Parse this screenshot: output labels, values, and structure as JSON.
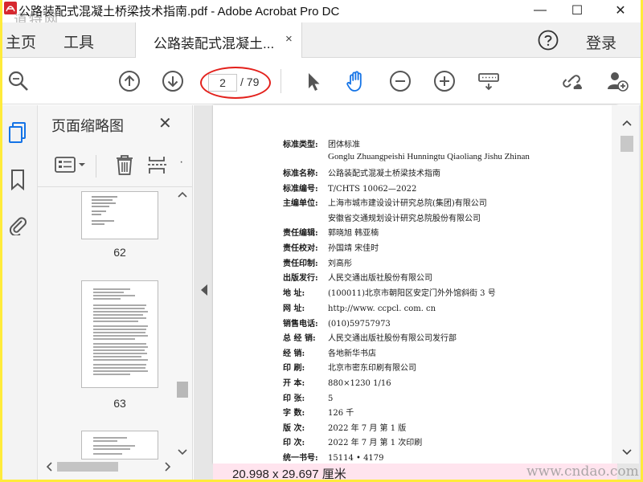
{
  "window": {
    "title": "公路装配式混凝土桥梁技术指南.pdf - Adobe Acrobat Pro DC",
    "watermark_top": "道特网",
    "controls": {
      "minimize": "—",
      "maximize": "☐",
      "close": "✕"
    }
  },
  "tabs": {
    "home": "主页",
    "tools": "工具",
    "document": "公路装配式混凝土...",
    "close": "×",
    "sign_in": "登录"
  },
  "toolbar": {
    "current_page": "2",
    "total_pages": "/ 79"
  },
  "panel": {
    "title": "页面缩略图",
    "close": "✕",
    "thumbnails": [
      {
        "label": "62"
      },
      {
        "label": "63"
      }
    ]
  },
  "document": {
    "fields": [
      {
        "label": "标准类型:",
        "value": "团体标准"
      },
      {
        "label": "标准名称:",
        "value": "公路装配式混凝土桥梁技术指南"
      },
      {
        "label": "标准编号:",
        "value": "T/CHTS  10062—2022"
      },
      {
        "label": "主编单位:",
        "value": "上海市城市建设设计研究总院(集团)有限公司"
      },
      {
        "label": "",
        "value": "安徽省交通规划设计研究总院股份有限公司"
      },
      {
        "label": "责任编辑:",
        "value": "郭晓旭    韩亚楠"
      },
      {
        "label": "责任校对:",
        "value": "孙国靖    宋佳时"
      },
      {
        "label": "责任印制:",
        "value": "刘高彤"
      },
      {
        "label": "出版发行:",
        "value": "人民交通出版社股份有限公司"
      },
      {
        "label": "地      址:",
        "value": "(100011)北京市朝阳区安定门外外馆斜街 3 号"
      },
      {
        "label": "网      址:",
        "value": "http://www. ccpcl. com. cn"
      },
      {
        "label": "销售电话:",
        "value": "(010)59757973"
      },
      {
        "label": "总  经  销:",
        "value": "人民交通出版社股份有限公司发行部"
      },
      {
        "label": "经      销:",
        "value": "各地新华书店"
      },
      {
        "label": "印      刷:",
        "value": "北京市密东印刷有限公司"
      },
      {
        "label": "开      本:",
        "value": "880×1230    1/16"
      },
      {
        "label": "印      张:",
        "value": "5"
      },
      {
        "label": "字      数:",
        "value": "126 千"
      },
      {
        "label": "版      次:",
        "value": "2022 年 7 月    第 1 版"
      },
      {
        "label": "印      次:",
        "value": "2022 年 7 月    第 1 次印刷"
      },
      {
        "label": "统一书号:",
        "value": "15114 • 4179"
      }
    ],
    "pinyin": "Gonglu Zhuangpeishi Hunningtu Qiaoliang Jishu Zhinan"
  },
  "status": {
    "page_size": "20.998 x 29.697 厘米",
    "watermark": "www.cndao.com"
  },
  "colors": {
    "accent_blue": "#1473e6",
    "annotation_red": "#e3211c",
    "frame_yellow": "#ffeb3b"
  },
  "icons": [
    "acrobat-icon",
    "help-icon",
    "zoom-icon",
    "page-up-icon",
    "page-down-icon",
    "select-arrow-icon",
    "hand-icon",
    "zoom-out-icon",
    "zoom-in-icon",
    "keyboard-icon",
    "share-link-icon",
    "add-user-icon",
    "thumbnails-icon",
    "bookmark-icon",
    "attachment-icon",
    "options-icon",
    "delete-icon",
    "insert-page-icon"
  ]
}
